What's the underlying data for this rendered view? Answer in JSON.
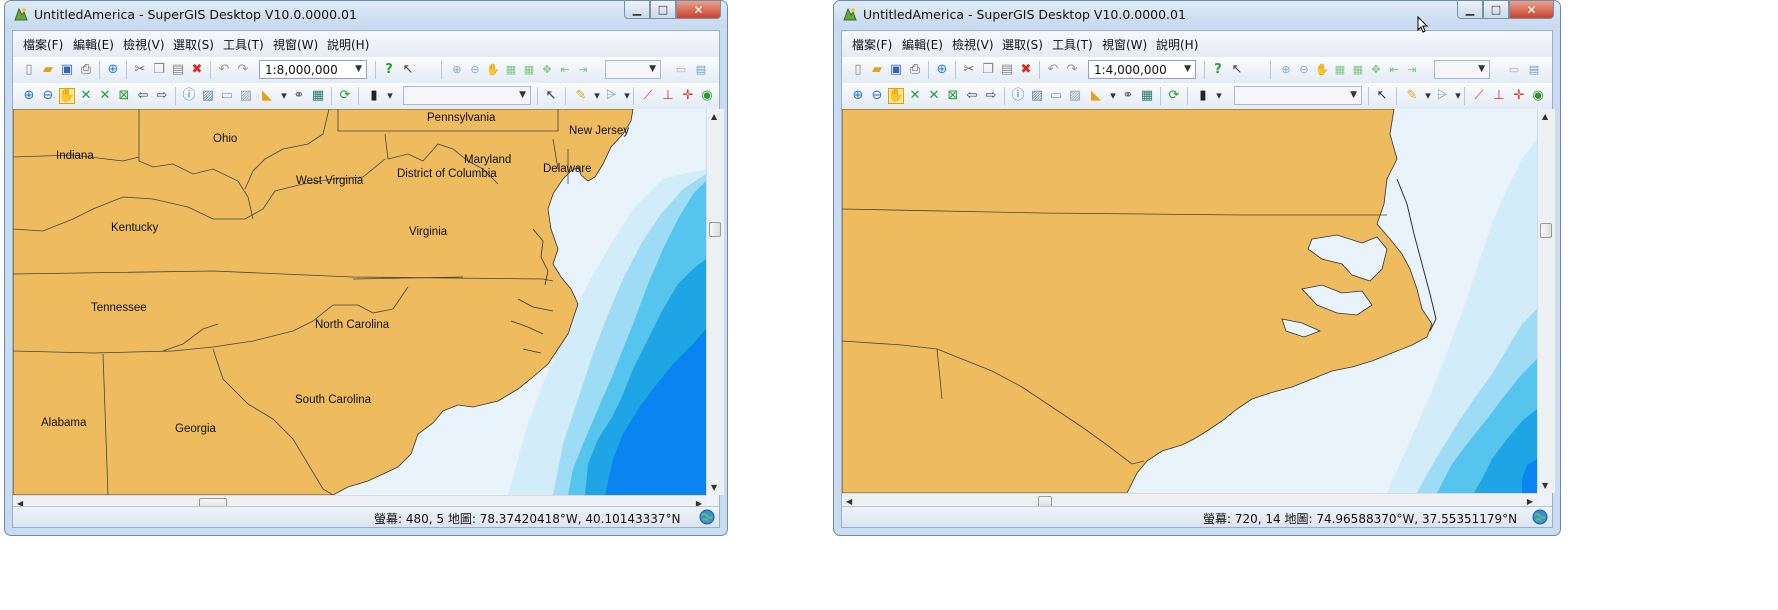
{
  "windows": [
    {
      "title": "UntitledAmerica - SuperGIS Desktop V10.0.0000.01",
      "menu": [
        "檔案(F)",
        "編輯(E)",
        "檢視(V)",
        "選取(S)",
        "工具(T)",
        "視窗(W)",
        "說明(H)"
      ],
      "scale": "1:8,000,000",
      "status": "螢幕: 480, 5  地圖: 78.37420418°W, 40.10143337°N",
      "labels": {
        "pennsylvania": "Pennsylvania",
        "new_jersey": "New Jersey",
        "ohio": "Ohio",
        "indiana": "Indiana",
        "maryland": "Maryland",
        "delaware": "Delaware",
        "west_virginia": "West Virginia",
        "district_of_columbia": "District of Columbia",
        "kentucky": "Kentucky",
        "virginia": "Virginia",
        "tennessee": "Tennessee",
        "north_carolina": "North Carolina",
        "south_carolina": "South Carolina",
        "alabama": "Alabama",
        "georgia": "Georgia"
      }
    },
    {
      "title": "UntitledAmerica - SuperGIS Desktop V10.0.0000.01",
      "menu": [
        "檔案(F)",
        "編輯(E)",
        "檢視(V)",
        "選取(S)",
        "工具(T)",
        "視窗(W)",
        "說明(H)"
      ],
      "scale": "1:4,000,000",
      "status": "螢幕: 720, 14  地圖: 74.96588370°W, 37.55351179°N"
    }
  ],
  "icons": [
    "app-icon",
    "new-icon",
    "open-icon",
    "save-icon",
    "print-icon",
    "add-data-icon",
    "cut-icon",
    "copy-icon",
    "paste-icon",
    "delete-icon",
    "undo-icon",
    "redo-icon",
    "help-icon",
    "whats-this-icon",
    "zoom-in-icon",
    "zoom-out-icon",
    "pan-icon",
    "full-extent-icon",
    "previous-extent-icon",
    "next-extent-icon",
    "identify-icon",
    "globe-icon"
  ],
  "colors": {
    "land": "#eebb5e",
    "shallow_water": "#e8f3fb",
    "water_2": "#d2ecfa",
    "water_3": "#9edbf4",
    "water_4": "#55c5ee",
    "water_5": "#1fa5e6",
    "deep_water": "#0a84f0",
    "close_button": "#c7422b"
  }
}
